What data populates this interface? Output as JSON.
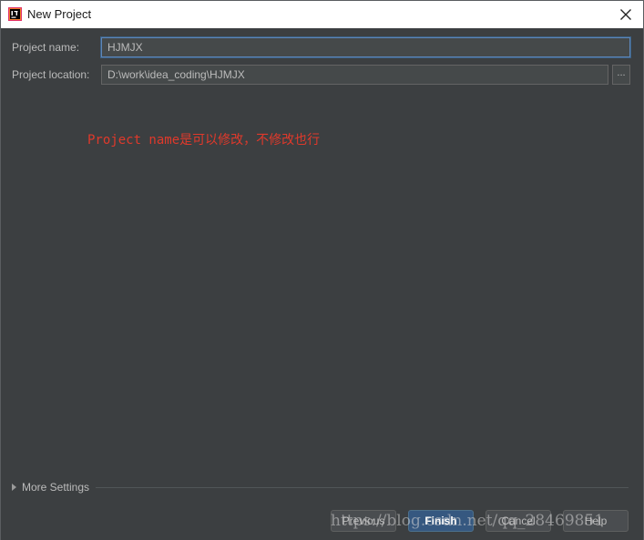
{
  "window": {
    "title": "New Project"
  },
  "form": {
    "name_label": "Project name:",
    "name_value": "HJMJX",
    "location_label": "Project location:",
    "location_value": "D:\\work\\idea_coding\\HJMJX",
    "browse_label": "..."
  },
  "annotation": {
    "text": "Project name是可以修改，不修改也行"
  },
  "more_settings": {
    "label": "More Settings"
  },
  "buttons": {
    "previous": "Previous",
    "finish": "Finish",
    "cancel": "Cancel",
    "help": "Help"
  },
  "watermark": {
    "text": "https://blog.csdn.net/qq_28469851"
  },
  "colors": {
    "background": "#3c3f41",
    "annotation": "#e0392b",
    "focus": "#5d86b8",
    "primary": "#365880"
  },
  "icons": {
    "app": "intellij-idea-icon",
    "close": "close-icon",
    "expand": "triangle-right-icon"
  }
}
